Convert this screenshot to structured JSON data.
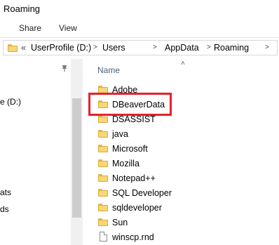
{
  "window": {
    "title": "Roaming"
  },
  "ribbon": {
    "tabs": [
      "Share",
      "View"
    ]
  },
  "address_bar": {
    "overflow": "«",
    "segments": [
      "UserProfile (D:)",
      "Users",
      "AppData",
      "Roaming"
    ]
  },
  "nav_pane": {
    "items": [
      "e (D:)",
      "ats",
      "ds"
    ]
  },
  "file_list": {
    "column_header": "Name",
    "items": [
      {
        "name": "Adobe",
        "type": "folder"
      },
      {
        "name": "DBeaverData",
        "type": "folder"
      },
      {
        "name": "DSASSIST",
        "type": "folder"
      },
      {
        "name": "java",
        "type": "folder"
      },
      {
        "name": "Microsoft",
        "type": "folder"
      },
      {
        "name": "Mozilla",
        "type": "folder"
      },
      {
        "name": "Notepad++",
        "type": "folder"
      },
      {
        "name": "SQL Developer",
        "type": "folder"
      },
      {
        "name": "sqldeveloper",
        "type": "folder"
      },
      {
        "name": "Sun",
        "type": "folder"
      },
      {
        "name": "winscp.rnd",
        "type": "file"
      }
    ]
  },
  "highlight": {
    "target": "DBeaverData",
    "color": "#e3232c"
  }
}
